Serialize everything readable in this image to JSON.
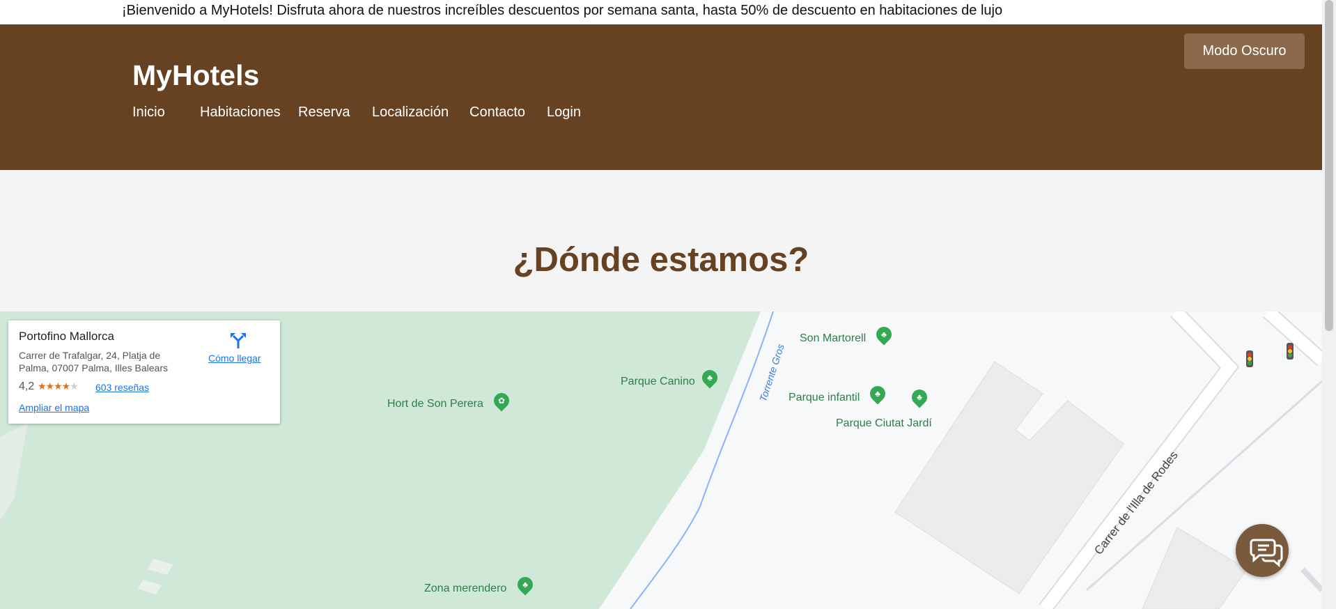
{
  "announcement": "¡Bienvenido a MyHotels! Disfruta ahora de nuestros increíbles descuentos por semana santa, hasta 50% de descuento en habitaciones de lujo",
  "header": {
    "brand": "MyHotels",
    "dark_mode_label": "Modo Oscuro",
    "nav": [
      "Inicio",
      "Habitaciones",
      "Reserva",
      "Localización",
      "Contacto",
      "Login"
    ]
  },
  "section": {
    "title": "¿Dónde estamos?"
  },
  "map": {
    "place_name": "Portofino Mallorca",
    "address": "Carrer de Trafalgar, 24, Platja de Palma, 07007 Palma, Illes Balears",
    "rating": "4,2",
    "stars": "★★★★",
    "reviews": "603 reseñas",
    "expand": "Ampliar el mapa",
    "directions": "Cómo llegar",
    "pois": [
      "Son Martorell",
      "Parque Canino",
      "Hort de Son Perera",
      "Parque infantil",
      "Parque Ciutat Jardí",
      "Zona merendero"
    ],
    "street": "Carrer de l'Illa de Rodes",
    "river": "Torrente Gros",
    "park_color": "#cfe8d8",
    "poi_color": "#34a853",
    "link_color": "#1a73e8"
  },
  "theme": {
    "primary": "#664223",
    "accent": "#8a6a4b",
    "title": "#664223"
  },
  "icons": {
    "chat": "chat-icon",
    "directions": "directions-icon",
    "traffic": "traffic-light-icon"
  }
}
